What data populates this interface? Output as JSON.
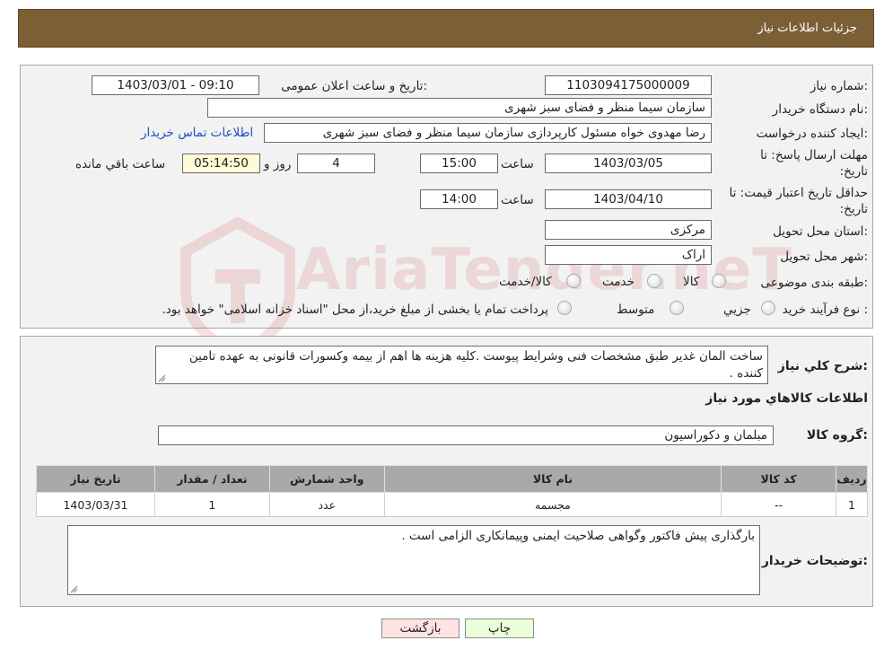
{
  "header": {
    "title": "جزئیات اطلاعات نیاز"
  },
  "watermark": {
    "text": "AriaTender.neT"
  },
  "form": {
    "need_number_label": "شماره نیاز:",
    "need_number": "1103094175000009",
    "announce_label": "تاریخ و ساعت اعلان عمومی:",
    "announce_value": "1403/03/01 - 09:10",
    "buyer_org_label": "نام دستگاه خریدار:",
    "buyer_org": "سازمان سیما منظر و فضای سبز شهری",
    "creator_label": "ایجاد کننده درخواست:",
    "creator": "رضا مهدوی خواه مسئول کارپردازی سازمان سیما منظر و فضای سبز شهری",
    "contact_link": "اطلاعات تماس خریدار",
    "deadline_label_line1": "مهلت ارسال پاسخ: تا",
    "deadline_label_line2": "تاریخ:",
    "deadline_date": "1403/03/05",
    "time_label": "ساعت",
    "deadline_time": "15:00",
    "days_value": "4",
    "days_label": "روز و",
    "remaining_time": "05:14:50",
    "remaining_label": "ساعت باقي مانده",
    "validity_label_line1": "حداقل تاریخ اعتبار قیمت: تا",
    "validity_label_line2": "تاریخ:",
    "validity_date": "1403/04/10",
    "validity_time": "14:00",
    "province_label": "استان محل تحویل:",
    "province": "مرکزی",
    "city_label": "شهر محل تحویل:",
    "city": "اراک",
    "category_label": "طبقه بندی موضوعی:",
    "category_options": [
      "کالا",
      "خدمت",
      "کالا/خدمت"
    ],
    "process_label": "نوع فرآیند خرید :",
    "process_options": [
      "جزيي",
      "متوسط"
    ],
    "payment_note": "پرداخت تمام یا بخشی از مبلغ خرید،از محل \"اسناد خزانه اسلامی\" خواهد بود."
  },
  "details": {
    "summary_label": "شرح کلي نياز:",
    "summary_text": "ساخت المان غدیر طبق مشخصات فنی  وشرایط پیوست .کلیه هزینه  ها  اهم از بیمه وکسورات قانونی به عهده تامین کننده .",
    "goods_info_title": "اطلاعات کالاهاي مورد نياز",
    "goods_group_label": "گروه کالا:",
    "goods_group": "مبلمان و دکوراسیون",
    "table": {
      "headers": [
        "رديف",
        "کد کالا",
        "نام کالا",
        "واحد شمارش",
        "تعداد / مقدار",
        "تاریخ نیاز"
      ],
      "rows": [
        [
          "1",
          "--",
          "مجسمه",
          "عدد",
          "1",
          "1403/03/31"
        ]
      ]
    },
    "buyer_notes_label": "توضیحات خریدار:",
    "buyer_notes": "بارگذاری پیش فاکتور وگواهی صلاحیت ایمنی وپیمانکاری الزامی است ."
  },
  "buttons": {
    "print": "چاپ",
    "back": "بازگشت"
  },
  "colors": {
    "header_bg": "#7c5f35",
    "print_btn": "#e9ffd9",
    "back_btn": "#ffe3e3",
    "link": "#1a4fc4"
  }
}
